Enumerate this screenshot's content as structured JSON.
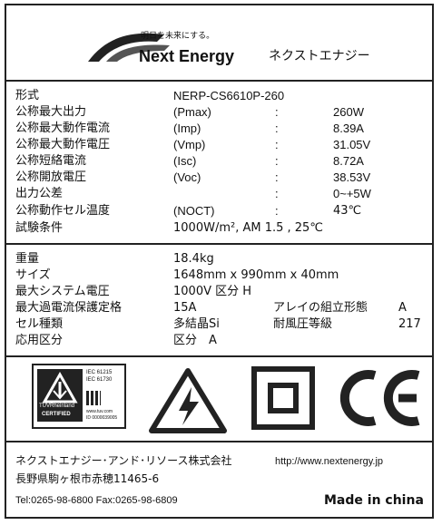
{
  "logo": {
    "tagline": "明日を未来にする。",
    "brand": "Next Energy",
    "brand_jp": "ネクストエナジー"
  },
  "specs": [
    {
      "label": "形式",
      "param": "NERP-CS6610P-260",
      "colon": "",
      "value": ""
    },
    {
      "label": "公称最大出力",
      "param": "(Pmax)",
      "colon": ":",
      "value": "260W"
    },
    {
      "label": "公称最大動作電流",
      "param": "(Imp)",
      "colon": ":",
      "value": "8.39A"
    },
    {
      "label": "公称最大動作電圧",
      "param": "(Vmp)",
      "colon": ":",
      "value": "31.05V"
    },
    {
      "label": "公称短絡電流",
      "param": "(Isc)",
      "colon": ":",
      "value": "8.72A"
    },
    {
      "label": "公称開放電圧",
      "param": "(Voc)",
      "colon": ":",
      "value": "38.53V"
    },
    {
      "label": "出力公差",
      "param": "",
      "colon": ":",
      "value": "0~+5W"
    },
    {
      "label": "公称動作セル温度",
      "param": "(NOCT)",
      "colon": ":",
      "value": "43℃"
    },
    {
      "label": "試験条件",
      "param": "1000W/m², AM 1.5 , 25℃",
      "colon": "",
      "value": ""
    }
  ],
  "physical": [
    {
      "label": "重量",
      "value": "18.4kg"
    },
    {
      "label": "サイズ",
      "value": "1648mm x 990mm x 40mm"
    },
    {
      "label": "最大システム電圧",
      "value": "1000V  区分 H"
    },
    {
      "label": "最大過電流保護定格",
      "value": "15A",
      "label2": "アレイの組立形態",
      "value2": "A"
    },
    {
      "label": "セル種類",
      "value": "多結晶Si",
      "label2": "耐風圧等級",
      "value2": "217"
    },
    {
      "label": "応用区分",
      "value": "区分　A"
    }
  ],
  "cert": {
    "iec1": "IEC 61215",
    "iec2": "IEC 61730",
    "tuv_brand": "TÜVRheinland",
    "tuv_cert": "CERTIFIED",
    "tuv_url": "www.tuv.com",
    "tuv_id": "ID 0000039005",
    "ce_mark": "CE"
  },
  "footer": {
    "company": "ネクストエナジー･アンド･リソース株式会社",
    "url": "http://www.nextenergy.jp",
    "address": "長野県駒ヶ根市赤穂11465-6",
    "phone": "Tel:0265-98-6800 Fax:0265-98-6809",
    "made_in": "Made in china"
  }
}
